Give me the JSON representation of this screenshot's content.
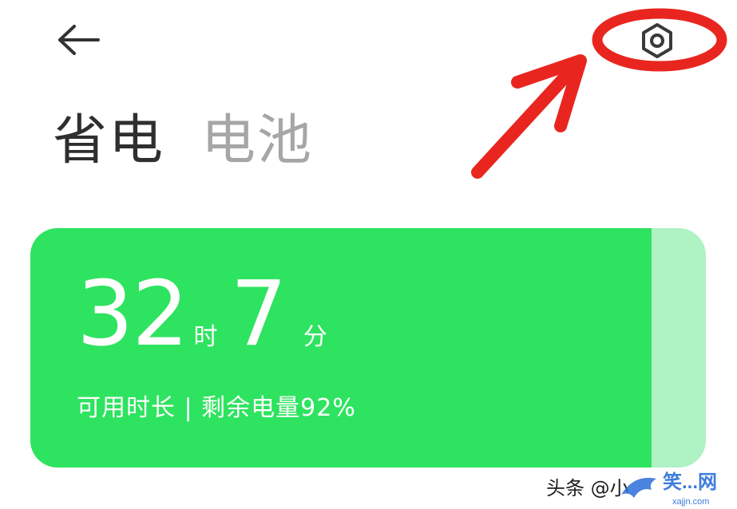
{
  "header": {
    "back_icon": "arrow-left-icon",
    "settings_icon": "hexagon-gear-icon"
  },
  "tabs": [
    {
      "label": "省电",
      "active": true
    },
    {
      "label": "电池",
      "active": false
    }
  ],
  "battery": {
    "hours": "32",
    "hours_unit": "时",
    "minutes": "7",
    "minutes_unit": "分",
    "subtitle": "可用时长 | 剩余电量92%",
    "level_percent": 92,
    "fill_color": "#2ee35f",
    "empty_color": "#aff2c4"
  },
  "annotation": {
    "color": "#e8261f",
    "shapes": [
      "ellipse",
      "arrow"
    ]
  },
  "watermark": {
    "text": "头条 @小",
    "logo_text": "笑...网",
    "logo_url_text": "xajjn.com"
  }
}
